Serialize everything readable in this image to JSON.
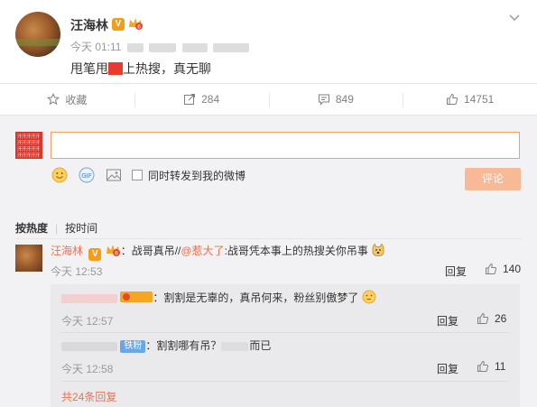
{
  "post": {
    "author": "汪海林",
    "time": "今天 01:11",
    "text_before": "甩笔甩",
    "text_after": "上热搜，真无聊"
  },
  "actions": {
    "favorite": "收藏",
    "repost_count": "284",
    "comment_count": "849",
    "like_count": "14751"
  },
  "composer": {
    "thumb_text": "汗汗汗汗汗汗汗汗汗汗汗汗汗汗汗汗汗汗汗汗汗汗汗汗",
    "sync_label": "同时转发到我的微博",
    "submit_label": "评论"
  },
  "sort": {
    "hot": "按热度",
    "time": "按时间"
  },
  "comment": {
    "author": "汪海林",
    "text_a": "：战哥真吊//",
    "mention": "@惹大了",
    "text_b": ":战哥凭本事上的热搜关你吊事",
    "time": "今天 12:53",
    "reply": "回复",
    "likes": "140"
  },
  "replies": [
    {
      "text": "：割割是无辜的，真吊何来，粉丝别傲梦了",
      "time": "今天 12:57",
      "reply": "回复",
      "likes": "26"
    },
    {
      "badge": "铁粉",
      "text_a": "：割割哪有吊？",
      "text_b": "而已",
      "time": "今天 12:58",
      "reply": "回复",
      "likes": "11"
    }
  ],
  "more_replies": "共24条回复"
}
